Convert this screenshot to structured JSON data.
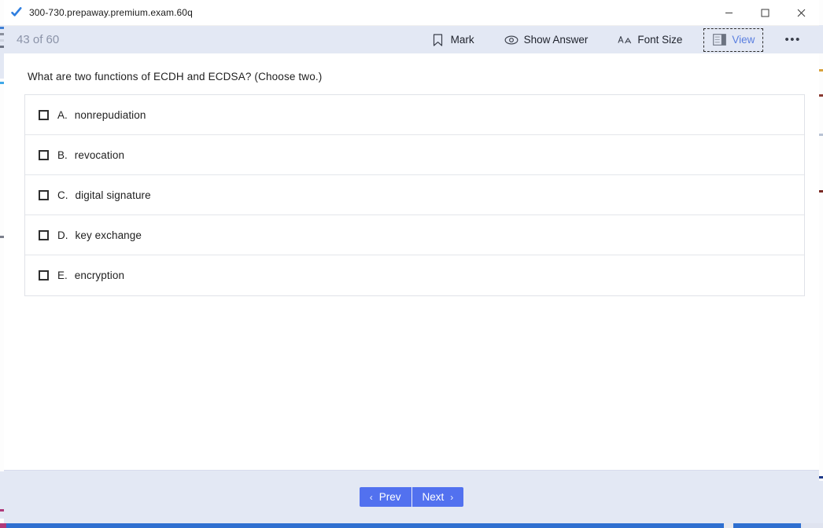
{
  "window": {
    "title": "300-730.prepaway.premium.exam.60q",
    "app_icon": "blue-checkmark-icon",
    "controls": {
      "minimize": "minimize-icon",
      "maximize": "maximize-icon",
      "close": "close-icon"
    }
  },
  "toolbar": {
    "progress": "43 of 60",
    "current_question": 43,
    "total_questions": 60,
    "buttons": [
      {
        "label": "Mark",
        "icon": "bookmark-icon",
        "focused": false
      },
      {
        "label": "Show Answer",
        "icon": "eye-icon",
        "focused": false
      },
      {
        "label": "Font Size",
        "icon": "font-size-icon",
        "focused": false
      },
      {
        "label": "View",
        "icon": "layout-panel-icon",
        "focused": true
      }
    ],
    "overflow_label": "•••"
  },
  "question": {
    "text": "What are two functions of ECDH and ECDSA? (Choose two.)",
    "options": [
      {
        "letter": "A.",
        "label": "nonrepudiation",
        "checked": false
      },
      {
        "letter": "B.",
        "label": "revocation",
        "checked": false
      },
      {
        "letter": "C.",
        "label": "digital signature",
        "checked": false
      },
      {
        "letter": "D.",
        "label": "key exchange",
        "checked": false
      },
      {
        "letter": "E.",
        "label": "encryption",
        "checked": false
      }
    ]
  },
  "footer": {
    "prev_label": "Prev",
    "next_label": "Next",
    "prev_chevron": "‹",
    "next_chevron": "›"
  },
  "colors": {
    "accent_blue": "#5271ef",
    "toolbar_bg": "#e3e8f4",
    "focus_text": "#5a7fe0",
    "progress_text": "#8b93a8"
  }
}
